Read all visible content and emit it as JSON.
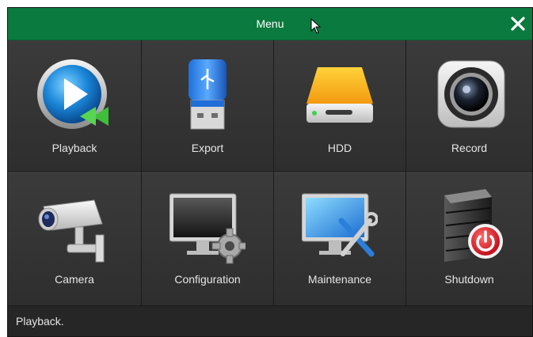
{
  "window": {
    "title": "Menu",
    "close_glyph": "✕",
    "title_bar_color": "#0b7a3e"
  },
  "tiles": [
    {
      "label": "Playback",
      "icon": "playback-icon"
    },
    {
      "label": "Export",
      "icon": "usb-drive-icon"
    },
    {
      "label": "HDD",
      "icon": "hard-drive-icon"
    },
    {
      "label": "Record",
      "icon": "camera-lens-icon"
    },
    {
      "label": "Camera",
      "icon": "security-camera-icon"
    },
    {
      "label": "Configuration",
      "icon": "monitor-gear-icon"
    },
    {
      "label": "Maintenance",
      "icon": "monitor-tools-icon"
    },
    {
      "label": "Shutdown",
      "icon": "server-power-icon"
    }
  ],
  "status": {
    "text": "Playback."
  }
}
